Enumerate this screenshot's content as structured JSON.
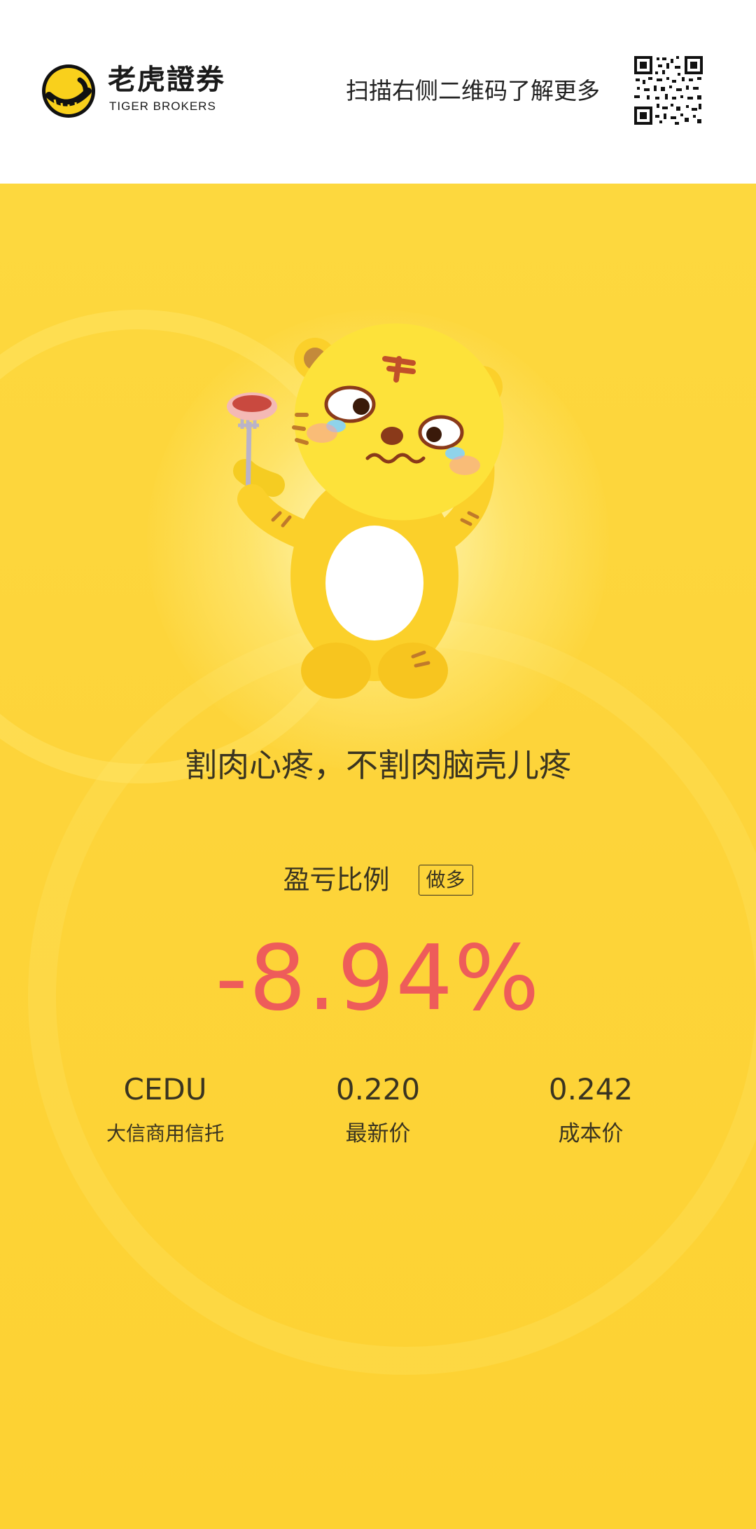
{
  "header": {
    "logo_cn": "老虎證券",
    "logo_en": "TIGER BROKERS",
    "scan_prompt": "扫描右侧二维码了解更多",
    "logo_icon": "tiger-logo-icon",
    "qr_icon": "qr-code-icon"
  },
  "poster": {
    "mascot": "crying-tiger-mascot",
    "slogan": "割肉心疼，不割肉脑壳儿疼",
    "ratio_label": "盈亏比例",
    "direction_badge": "做多",
    "pnl_percent": "-8.94%",
    "stock": {
      "symbol": "CEDU",
      "name": "大信商用信托"
    },
    "latest_price": {
      "value": "0.220",
      "label": "最新价"
    },
    "cost_price": {
      "value": "0.242",
      "label": "成本价"
    }
  },
  "colors": {
    "background": "#fdd83e",
    "loss_red": "#ee5c5a",
    "text_dark": "#3a3420",
    "logo_yellow": "#f9d01c"
  }
}
